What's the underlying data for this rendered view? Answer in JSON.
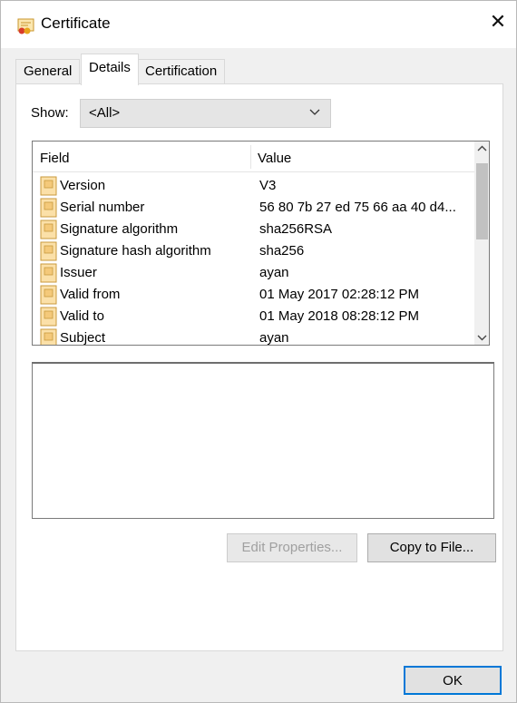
{
  "window": {
    "title": "Certificate",
    "close_glyph": "✕",
    "icon": "certificate-icon"
  },
  "tabs": [
    {
      "label": "General",
      "active": false
    },
    {
      "label": "Details",
      "active": true
    },
    {
      "label": "Certification Path",
      "active": false
    }
  ],
  "show": {
    "label": "Show:",
    "value": "<All>"
  },
  "list": {
    "columns": {
      "field": "Field",
      "value": "Value"
    },
    "rows": [
      {
        "field": "Version",
        "value": "V3"
      },
      {
        "field": "Serial number",
        "value": "56 80 7b 27 ed 75 66 aa 40 d4..."
      },
      {
        "field": "Signature algorithm",
        "value": "sha256RSA"
      },
      {
        "field": "Signature hash algorithm",
        "value": "sha256"
      },
      {
        "field": "Issuer",
        "value": "ayan"
      },
      {
        "field": "Valid from",
        "value": "01 May 2017 02:28:12 PM"
      },
      {
        "field": "Valid to",
        "value": "01 May 2018 08:28:12 PM"
      },
      {
        "field": "Subject",
        "value": "ayan"
      }
    ]
  },
  "buttons": {
    "edit_properties": "Edit Properties...",
    "copy_to_file": "Copy to File...",
    "ok": "OK"
  }
}
